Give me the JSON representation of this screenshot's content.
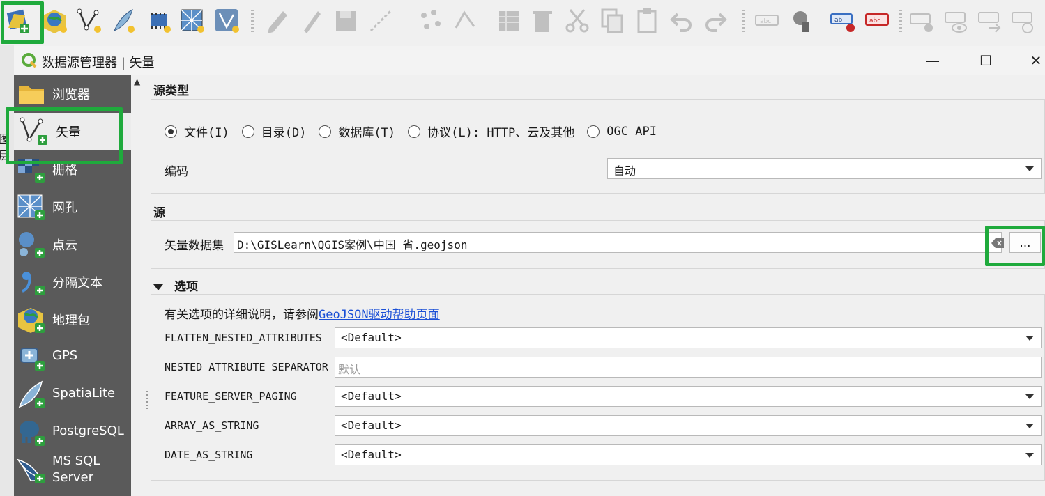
{
  "dialog": {
    "title": "数据源管理器 | 矢量",
    "window_controls": {
      "minimize": "—",
      "maximize": "☐",
      "close": "✕"
    }
  },
  "background": {
    "panel_label": "图层"
  },
  "sidebar": {
    "items": [
      {
        "label": "浏览器",
        "icon": "folder-icon"
      },
      {
        "label": "矢量",
        "icon": "vector-layer-icon",
        "active": true
      },
      {
        "label": "栅格",
        "icon": "raster-layer-icon"
      },
      {
        "label": "网孔",
        "icon": "mesh-layer-icon"
      },
      {
        "label": "点云",
        "icon": "point-cloud-icon"
      },
      {
        "label": "分隔文本",
        "icon": "delimited-text-icon"
      },
      {
        "label": "地理包",
        "icon": "geopackage-icon"
      },
      {
        "label": "GPS",
        "icon": "gps-icon"
      },
      {
        "label": "SpatiaLite",
        "icon": "spatialite-icon"
      },
      {
        "label": "PostgreSQL",
        "icon": "postgresql-icon"
      },
      {
        "label": "MS SQL Server",
        "icon": "mssql-icon"
      }
    ]
  },
  "source_type": {
    "title": "源类型",
    "options": [
      {
        "label": "文件(I)",
        "selected": true
      },
      {
        "label": "目录(D)",
        "selected": false
      },
      {
        "label": "数据库(T)",
        "selected": false
      },
      {
        "label": "协议(L): HTTP、云及其他",
        "selected": false
      },
      {
        "label": "OGC API",
        "selected": false
      }
    ],
    "encoding_label": "编码",
    "encoding_value": "自动"
  },
  "source": {
    "title": "源",
    "dataset_label": "矢量数据集",
    "dataset_value": "D:\\GISLearn\\QGIS案例\\中国_省.geojson",
    "browse_label": "…"
  },
  "options": {
    "title": "选项",
    "help_prefix": "有关选项的详细说明，请参阅",
    "help_link": "GeoJSON驱动帮助页面",
    "fields": [
      {
        "label": "FLATTEN_NESTED_ATTRIBUTES",
        "type": "select",
        "value": "<Default>"
      },
      {
        "label": "NESTED_ATTRIBUTE_SEPARATOR",
        "type": "input",
        "placeholder": "默认"
      },
      {
        "label": "FEATURE_SERVER_PAGING",
        "type": "select",
        "value": "<Default>"
      },
      {
        "label": "ARRAY_AS_STRING",
        "type": "select",
        "value": "<Default>"
      },
      {
        "label": "DATE_AS_STRING",
        "type": "select",
        "value": "<Default>"
      }
    ]
  },
  "colors": {
    "highlight": "#1faa3c",
    "sidebar_bg": "#5a5a5a",
    "link": "#1a4fd6"
  }
}
